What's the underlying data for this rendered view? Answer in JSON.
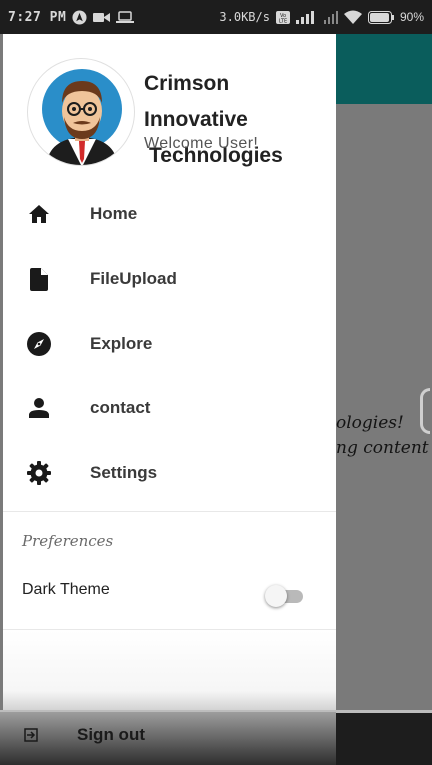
{
  "status_bar": {
    "time": "7:27 PM",
    "network_speed": "3.0KB/s",
    "battery": "90%",
    "icons": [
      "navigation-icon",
      "video-camera-icon",
      "laptop-icon",
      "volte-icon",
      "signal-icon",
      "wifi-icon",
      "battery-icon"
    ]
  },
  "drawer": {
    "header": {
      "company_line1": "Crimson Innovative",
      "company_line2": "Technologies",
      "welcome": "Welcome User!"
    },
    "nav_items": [
      {
        "label": "Home",
        "icon": "home-icon"
      },
      {
        "label": "FileUpload",
        "icon": "file-icon"
      },
      {
        "label": "Explore",
        "icon": "compass-icon"
      },
      {
        "label": "contact",
        "icon": "person-icon"
      },
      {
        "label": "Settings",
        "icon": "gear-icon"
      }
    ],
    "preferences": {
      "title": "Preferences",
      "dark_theme_label": "Dark Theme",
      "dark_theme_on": false
    },
    "sign_out": {
      "label": "Sign out",
      "icon": "sign-out-icon"
    }
  },
  "background_app": {
    "text_line1": "ologies!",
    "text_line2": "ng content"
  },
  "colors": {
    "toolbar": "#0a5d5c",
    "scrim": "#7a7a7a",
    "drawer_bg": "#ffffff",
    "icon": "#1a1a1a"
  }
}
